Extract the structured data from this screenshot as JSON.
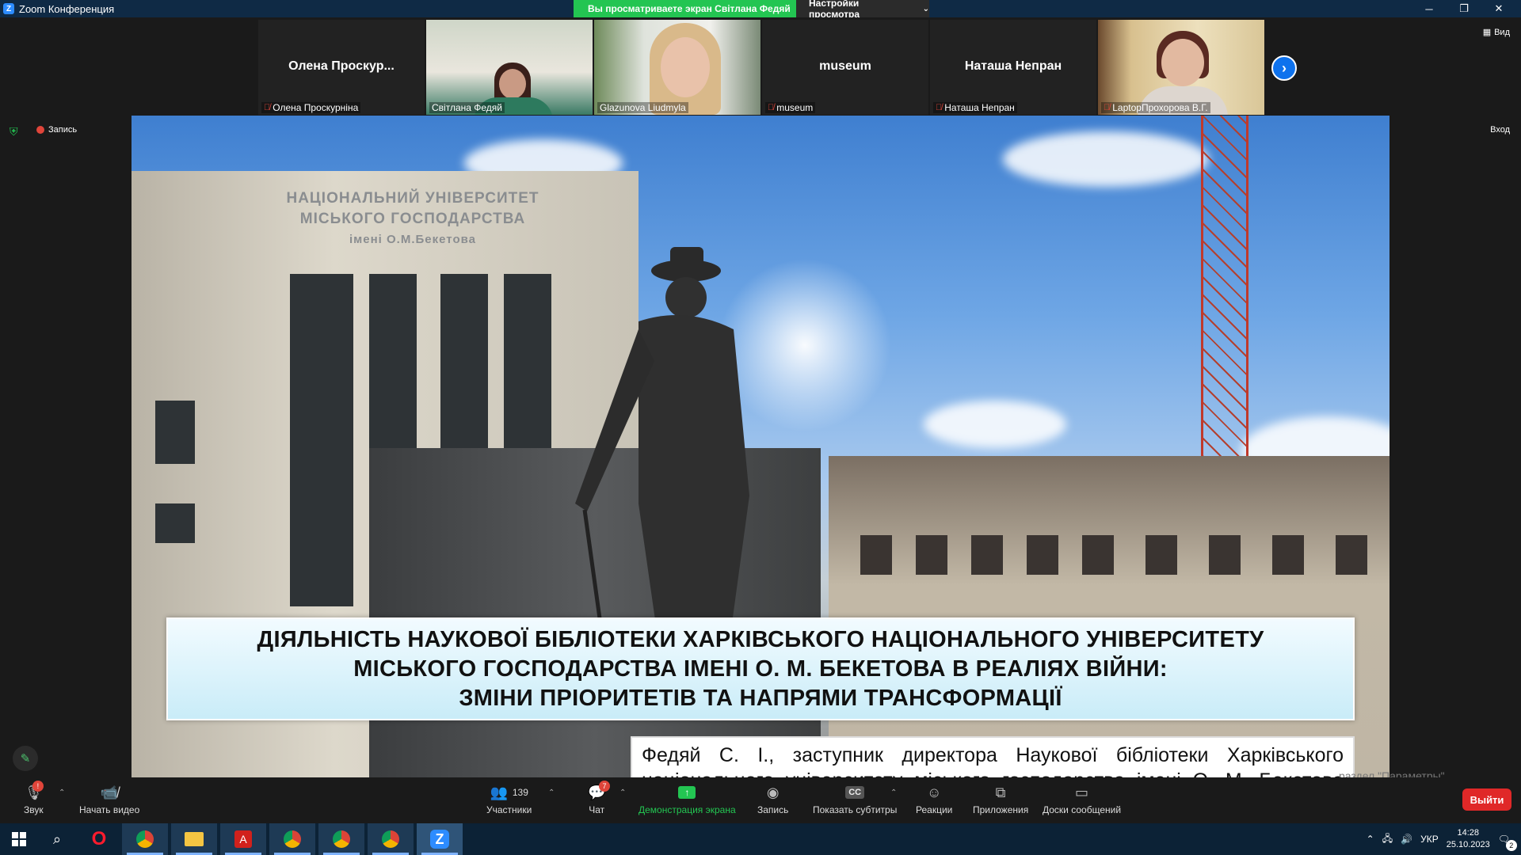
{
  "window": {
    "title": "Zoom Конференция",
    "share_banner": "Вы просматриваете экран Світлана Федяй",
    "view_settings": "Настройки просмотра",
    "view_button": "Вид",
    "login_button": "Вход",
    "recording_label": "Запись"
  },
  "gallery": [
    {
      "big_name": "Олена  Проскур...",
      "small_name": "Олена Проскурніна",
      "muted": true,
      "video": false
    },
    {
      "big_name": "",
      "small_name": "Світлана Федяй",
      "muted": false,
      "video": true,
      "active": true
    },
    {
      "big_name": "",
      "small_name": "Glazunova Liudmyla",
      "muted": false,
      "video": true
    },
    {
      "big_name": "museum",
      "small_name": "museum",
      "muted": true,
      "video": false
    },
    {
      "big_name": "Наташа Непран",
      "small_name": "Наташа Непран",
      "muted": true,
      "video": false
    },
    {
      "big_name": "",
      "small_name": "LaptopПрохорова В.Г.",
      "muted": true,
      "video": true
    }
  ],
  "slide": {
    "building_sign": [
      "НАЦІОНАЛЬНИЙ УНІВЕРСИТЕТ",
      "МІСЬКОГО ГОСПОДАРСТВА",
      "імені О.М.Бекетова"
    ],
    "title_lines": [
      "ДІЯЛЬНІСТЬ НАУКОВОЇ БІБЛІОТЕКИ ХАРКІВСЬКОГО НАЦІОНАЛЬНОГО УНІВЕРСИТЕТУ",
      "МІСЬКОГО ГОСПОДАРСТВА ІМЕНІ О. М. БЕКЕТОВА В РЕАЛІЯХ ВІЙНИ:",
      "ЗМІНИ ПРІОРИТЕТІВ ТА НАПРЯМИ ТРАНСФОРМАЦІЇ"
    ],
    "author_lines": [
      "Федяй С. І., заступник директора Наукової бібліотеки Харківського",
      "національного університету міського господарства імені О. М. Бекетова"
    ]
  },
  "watermark": "раздел \"Параметры\".",
  "toolbar": {
    "audio": "Звук",
    "audio_badge": "!",
    "video": "Начать видео",
    "participants": "Участники",
    "participants_count": "139",
    "chat": "Чат",
    "chat_badge": "7",
    "share": "Демонстрация экрана",
    "record": "Запись",
    "captions": "Показать субтитры",
    "captions_icon": "CC",
    "reactions": "Реакции",
    "apps": "Приложения",
    "whiteboards": "Доски сообщений",
    "leave": "Выйти"
  },
  "taskbar": {
    "language": "УКР",
    "time": "14:28",
    "date": "25.10.2023",
    "notifications": "2"
  },
  "colors": {
    "share_green": "#23c552",
    "leave_red": "#e02828",
    "zoom_blue": "#0e72ed"
  }
}
